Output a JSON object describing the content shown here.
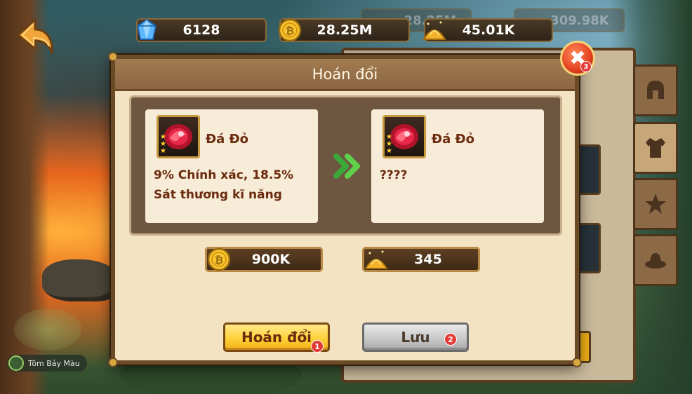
{
  "currencies": {
    "gems": "6128",
    "gold": "28.25M",
    "dust": "45.01K"
  },
  "ghost_currencies": {
    "gold": "28.25M",
    "other": "309.98K"
  },
  "dialog": {
    "title": "Hoán đổi",
    "left_item": {
      "name": "Đá Đỏ",
      "description": "9% Chính xác, 18.5% Sát thương kĩ năng",
      "stars": 3
    },
    "right_item": {
      "name": "Đá Đỏ",
      "description": "????",
      "stars": 3
    },
    "cost_gold": "900K",
    "cost_dust": "345",
    "swap_button": "Hoán đổi",
    "save_button": "Lưu",
    "badges": {
      "swap": "1",
      "save": "2",
      "close": "3"
    }
  },
  "character": {
    "name": "Tôm Bảy Màu"
  },
  "colors": {
    "dialog_bg": "#f3e3c3",
    "header_bg": "#8b6641",
    "primary_button": "#ffd23a",
    "secondary_button": "#c9c9c9",
    "badge": "#e53935",
    "text_dark_red": "#6b2b0e"
  },
  "icons": {
    "back": "back-arrow-icon",
    "gem": "gem-icon",
    "gold": "gold-coin-icon",
    "dust": "gold-dust-pile-icon",
    "close": "close-icon",
    "item": "red-gem-item-icon",
    "arrow": "double-chevron-right-icon"
  }
}
